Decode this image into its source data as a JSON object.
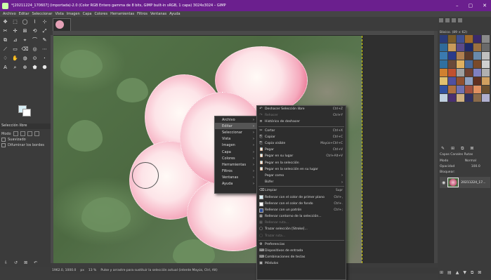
{
  "window": {
    "title": "*[20211224_170607] (importada)-2.0 (Color RGB Entero gamma de 8 bits, GIMP built-in sRGB, 1 capa) 3024x3024 – GIMP",
    "controls": [
      "–",
      "▢",
      "✕"
    ]
  },
  "menubar": [
    "Archivo",
    "Editar",
    "Seleccionar",
    "Vista",
    "Imagen",
    "Capa",
    "Colores",
    "Herramientas",
    "Filtros",
    "Ventanas",
    "Ayuda"
  ],
  "toolbox": {
    "tools": [
      "✥",
      "⬚",
      "◯",
      "⌇",
      "⊹",
      "✂",
      "✢",
      "⊞",
      "⟲",
      "⤢",
      "⧉",
      "⊿",
      "⌖",
      "⌒",
      "✎",
      "⟋",
      "▭",
      "⌫",
      "◎",
      "⋯",
      "♢",
      "✋",
      "◍",
      "⊙",
      "ꞏ",
      "A",
      "⌕",
      "⊕",
      "⬟",
      "⬣"
    ],
    "panel_title": "Selección libre",
    "mode_label": "Modo",
    "antialias_label": "Suavizado",
    "feather_label": "Difuminar los bordes"
  },
  "status": {
    "coords": "1962.0, 1000.0",
    "unit": "px",
    "zoom": "13 %",
    "message": "Pulse y arrastre para sustituir la selección actual (intente Mayús, Ctrl, Alt)"
  },
  "dock": {
    "brushes_label": "Básico. (89 × 62)",
    "layer_mode_label": "Modo",
    "layer_mode_value": "Normal",
    "opacity_label": "Opacidad",
    "opacity_value": "100.0",
    "lock_label": "Bloquear:",
    "layers_tabs": "Capas  Canales  Rutas",
    "layer_name": "20211224_17..."
  },
  "menu_main": [
    {
      "label": "Archivo",
      "highlight": false
    },
    {
      "label": "Editar",
      "highlight": true
    },
    {
      "label": "Seleccionar",
      "highlight": false
    },
    {
      "label": "Vista",
      "highlight": false
    },
    {
      "label": "Imagen",
      "highlight": false
    },
    {
      "label": "Capa",
      "highlight": false
    },
    {
      "label": "Colores",
      "highlight": false
    },
    {
      "label": "Herramientas",
      "highlight": false
    },
    {
      "label": "Filtros",
      "highlight": false
    },
    {
      "label": "Ventanas",
      "highlight": false
    },
    {
      "label": "Ayuda",
      "highlight": false
    }
  ],
  "menu_edit": [
    {
      "label": "Deshacer Selección libre",
      "shortcut": "Ctrl+Z",
      "icon": "↶",
      "disabled": false
    },
    {
      "label": "Rehacer",
      "shortcut": "Ctrl+Y",
      "icon": "↷",
      "disabled": true
    },
    {
      "label": "Histórico de deshacer",
      "shortcut": "",
      "icon": "≡",
      "disabled": false
    },
    {
      "sep": true
    },
    {
      "label": "Cortar",
      "shortcut": "Ctrl+X",
      "icon": "✂",
      "disabled": false
    },
    {
      "label": "Copiar",
      "shortcut": "Ctrl+C",
      "icon": "⎘",
      "disabled": false
    },
    {
      "label": "Copia visible",
      "shortcut": "Mayús+Ctrl+C",
      "icon": "⎘",
      "disabled": false
    },
    {
      "label": "Pegar",
      "shortcut": "Ctrl+V",
      "icon": "📋",
      "disabled": false
    },
    {
      "label": "Pegar en su lugar",
      "shortcut": "Ctrl+Alt+V",
      "icon": "📋",
      "disabled": false
    },
    {
      "label": "Pegar en la selección",
      "shortcut": "",
      "icon": "📋",
      "disabled": false
    },
    {
      "label": "Pegar en la selección en su lugar",
      "shortcut": "",
      "icon": "📋",
      "disabled": false
    },
    {
      "label": "Pegar como",
      "shortcut": "",
      "icon": "",
      "disabled": false,
      "submenu": true
    },
    {
      "label": "Búfer",
      "shortcut": "",
      "icon": "",
      "disabled": false,
      "submenu": true
    },
    {
      "sep": true
    },
    {
      "label": "Limpiar",
      "shortcut": "Supr",
      "icon": "⌫",
      "disabled": false
    },
    {
      "label": "Rellenar con el color de primer plano",
      "shortcut": "Ctrl+,",
      "swatch": "#d7eef5",
      "disabled": false
    },
    {
      "label": "Rellenar con el color de fondo",
      "shortcut": "Ctrl+.",
      "swatch": "#ffffff",
      "disabled": false
    },
    {
      "label": "Rellenar con un patrón",
      "shortcut": "Ctrl+;",
      "swatch": "#2a4b9a",
      "disabled": false
    },
    {
      "label": "Rellenar contorno de la selección...",
      "shortcut": "",
      "icon": "▦",
      "disabled": false
    },
    {
      "label": "Rellenar ruta...",
      "shortcut": "",
      "icon": "▦",
      "disabled": true
    },
    {
      "label": "Trazar selección [Stroke]...",
      "shortcut": "",
      "icon": "▢",
      "disabled": false
    },
    {
      "label": "Trazar ruta...",
      "shortcut": "",
      "icon": "▢",
      "disabled": true
    },
    {
      "sep": true
    },
    {
      "label": "Preferencias",
      "shortcut": "",
      "icon": "⚙",
      "disabled": false
    },
    {
      "label": "Dispositivos de entrada",
      "shortcut": "",
      "icon": "⌨",
      "disabled": false
    },
    {
      "label": "Combinaciones de teclas",
      "shortcut": "",
      "icon": "⌨",
      "disabled": false
    },
    {
      "label": "Módulos",
      "shortcut": "",
      "icon": "▣",
      "disabled": false
    }
  ],
  "colors": {
    "titlebar": "#6b1f8e",
    "petal_edge": "#dc3c64",
    "canvas_boundary": "#d9d000"
  }
}
